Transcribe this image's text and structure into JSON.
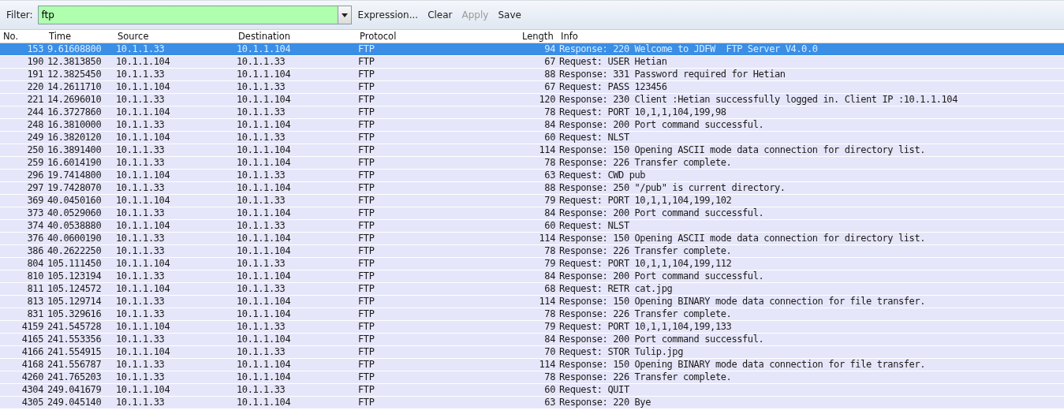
{
  "filter_bar": {
    "label": "Filter:",
    "value": "ftp",
    "buttons": [
      {
        "label": "Expression...",
        "disabled": false
      },
      {
        "label": "Clear",
        "disabled": false
      },
      {
        "label": "Apply",
        "disabled": true
      },
      {
        "label": "Save",
        "disabled": false
      }
    ]
  },
  "table": {
    "columns": [
      "No.",
      "Time",
      "Source",
      "Destination",
      "Protocol",
      "Length",
      "Info"
    ],
    "rows": [
      {
        "no": "153",
        "time": "9.61608800",
        "source": "10.1.1.33",
        "destination": "10.1.1.104",
        "protocol": "FTP",
        "length": "94",
        "info": "Response: 220 Welcome to JDFW  FTP Server V4.0.0",
        "selected": true
      },
      {
        "no": "190",
        "time": "12.3813850",
        "source": "10.1.1.104",
        "destination": "10.1.1.33",
        "protocol": "FTP",
        "length": "67",
        "info": "Request: USER Hetian",
        "selected": false
      },
      {
        "no": "191",
        "time": "12.3825450",
        "source": "10.1.1.33",
        "destination": "10.1.1.104",
        "protocol": "FTP",
        "length": "88",
        "info": "Response: 331 Password required for Hetian",
        "selected": false
      },
      {
        "no": "220",
        "time": "14.2611710",
        "source": "10.1.1.104",
        "destination": "10.1.1.33",
        "protocol": "FTP",
        "length": "67",
        "info": "Request: PASS 123456",
        "selected": false
      },
      {
        "no": "221",
        "time": "14.2696010",
        "source": "10.1.1.33",
        "destination": "10.1.1.104",
        "protocol": "FTP",
        "length": "120",
        "info": "Response: 230 Client :Hetian successfully logged in. Client IP :10.1.1.104",
        "selected": false
      },
      {
        "no": "244",
        "time": "16.3727860",
        "source": "10.1.1.104",
        "destination": "10.1.1.33",
        "protocol": "FTP",
        "length": "78",
        "info": "Request: PORT 10,1,1,104,199,98",
        "selected": false
      },
      {
        "no": "248",
        "time": "16.3810000",
        "source": "10.1.1.33",
        "destination": "10.1.1.104",
        "protocol": "FTP",
        "length": "84",
        "info": "Response: 200 Port command successful.",
        "selected": false
      },
      {
        "no": "249",
        "time": "16.3820120",
        "source": "10.1.1.104",
        "destination": "10.1.1.33",
        "protocol": "FTP",
        "length": "60",
        "info": "Request: NLST",
        "selected": false
      },
      {
        "no": "250",
        "time": "16.3891400",
        "source": "10.1.1.33",
        "destination": "10.1.1.104",
        "protocol": "FTP",
        "length": "114",
        "info": "Response: 150 Opening ASCII mode data connection for directory list.",
        "selected": false
      },
      {
        "no": "259",
        "time": "16.6014190",
        "source": "10.1.1.33",
        "destination": "10.1.1.104",
        "protocol": "FTP",
        "length": "78",
        "info": "Response: 226 Transfer complete.",
        "selected": false
      },
      {
        "no": "296",
        "time": "19.7414800",
        "source": "10.1.1.104",
        "destination": "10.1.1.33",
        "protocol": "FTP",
        "length": "63",
        "info": "Request: CWD pub",
        "selected": false
      },
      {
        "no": "297",
        "time": "19.7428070",
        "source": "10.1.1.33",
        "destination": "10.1.1.104",
        "protocol": "FTP",
        "length": "88",
        "info": "Response: 250 \"/pub\" is current directory.",
        "selected": false
      },
      {
        "no": "369",
        "time": "40.0450160",
        "source": "10.1.1.104",
        "destination": "10.1.1.33",
        "protocol": "FTP",
        "length": "79",
        "info": "Request: PORT 10,1,1,104,199,102",
        "selected": false
      },
      {
        "no": "373",
        "time": "40.0529060",
        "source": "10.1.1.33",
        "destination": "10.1.1.104",
        "protocol": "FTP",
        "length": "84",
        "info": "Response: 200 Port command successful.",
        "selected": false
      },
      {
        "no": "374",
        "time": "40.0538880",
        "source": "10.1.1.104",
        "destination": "10.1.1.33",
        "protocol": "FTP",
        "length": "60",
        "info": "Request: NLST",
        "selected": false
      },
      {
        "no": "376",
        "time": "40.0600190",
        "source": "10.1.1.33",
        "destination": "10.1.1.104",
        "protocol": "FTP",
        "length": "114",
        "info": "Response: 150 Opening ASCII mode data connection for directory list.",
        "selected": false
      },
      {
        "no": "386",
        "time": "40.2622250",
        "source": "10.1.1.33",
        "destination": "10.1.1.104",
        "protocol": "FTP",
        "length": "78",
        "info": "Response: 226 Transfer complete.",
        "selected": false
      },
      {
        "no": "804",
        "time": "105.111450",
        "source": "10.1.1.104",
        "destination": "10.1.1.33",
        "protocol": "FTP",
        "length": "79",
        "info": "Request: PORT 10,1,1,104,199,112",
        "selected": false
      },
      {
        "no": "810",
        "time": "105.123194",
        "source": "10.1.1.33",
        "destination": "10.1.1.104",
        "protocol": "FTP",
        "length": "84",
        "info": "Response: 200 Port command successful.",
        "selected": false
      },
      {
        "no": "811",
        "time": "105.124572",
        "source": "10.1.1.104",
        "destination": "10.1.1.33",
        "protocol": "FTP",
        "length": "68",
        "info": "Request: RETR cat.jpg",
        "selected": false
      },
      {
        "no": "813",
        "time": "105.129714",
        "source": "10.1.1.33",
        "destination": "10.1.1.104",
        "protocol": "FTP",
        "length": "114",
        "info": "Response: 150 Opening BINARY mode data connection for file transfer.",
        "selected": false
      },
      {
        "no": "831",
        "time": "105.329616",
        "source": "10.1.1.33",
        "destination": "10.1.1.104",
        "protocol": "FTP",
        "length": "78",
        "info": "Response: 226 Transfer complete.",
        "selected": false
      },
      {
        "no": "4159",
        "time": "241.545728",
        "source": "10.1.1.104",
        "destination": "10.1.1.33",
        "protocol": "FTP",
        "length": "79",
        "info": "Request: PORT 10,1,1,104,199,133",
        "selected": false
      },
      {
        "no": "4165",
        "time": "241.553356",
        "source": "10.1.1.33",
        "destination": "10.1.1.104",
        "protocol": "FTP",
        "length": "84",
        "info": "Response: 200 Port command successful.",
        "selected": false
      },
      {
        "no": "4166",
        "time": "241.554915",
        "source": "10.1.1.104",
        "destination": "10.1.1.33",
        "protocol": "FTP",
        "length": "70",
        "info": "Request: STOR Tulip.jpg",
        "selected": false
      },
      {
        "no": "4168",
        "time": "241.556787",
        "source": "10.1.1.33",
        "destination": "10.1.1.104",
        "protocol": "FTP",
        "length": "114",
        "info": "Response: 150 Opening BINARY mode data connection for file transfer.",
        "selected": false
      },
      {
        "no": "4260",
        "time": "241.765203",
        "source": "10.1.1.33",
        "destination": "10.1.1.104",
        "protocol": "FTP",
        "length": "78",
        "info": "Response: 226 Transfer complete.",
        "selected": false
      },
      {
        "no": "4304",
        "time": "249.041679",
        "source": "10.1.1.104",
        "destination": "10.1.1.33",
        "protocol": "FTP",
        "length": "60",
        "info": "Request: QUIT",
        "selected": false
      },
      {
        "no": "4305",
        "time": "249.045140",
        "source": "10.1.1.33",
        "destination": "10.1.1.104",
        "protocol": "FTP",
        "length": "63",
        "info": "Response: 220 Bye",
        "selected": false
      }
    ]
  }
}
